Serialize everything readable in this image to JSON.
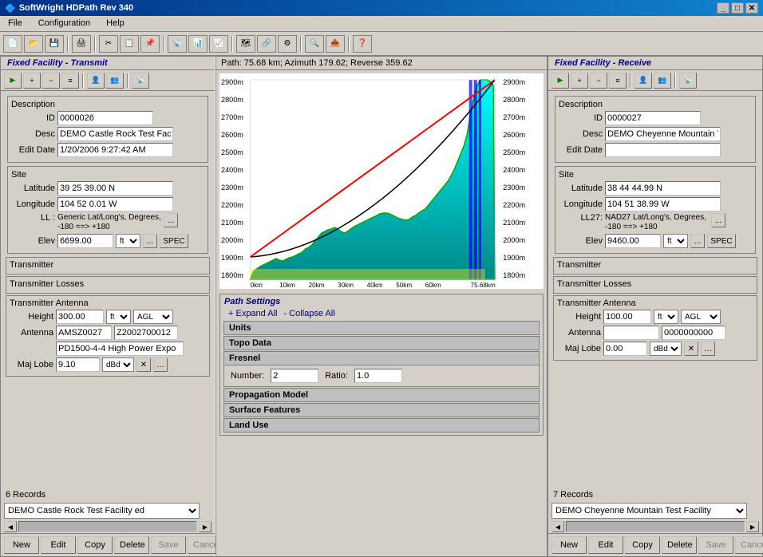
{
  "window": {
    "title": "SoftWright HDPath Rev 340",
    "title_icon": "sw-icon"
  },
  "menu": {
    "items": [
      "File",
      "Configuration",
      "Help"
    ]
  },
  "toolbar": {
    "buttons": [
      "new",
      "open",
      "save",
      "print",
      "cut",
      "copy",
      "paste",
      "undo",
      "find",
      "zoom",
      "help",
      "about"
    ]
  },
  "left_panel": {
    "header": "Fixed Facility - Transmit",
    "mini_toolbar": [
      "green-arrow",
      "plus",
      "minus",
      "list",
      "person",
      "person2",
      "tx-icon"
    ],
    "description": {
      "title": "Description",
      "id_label": "ID",
      "id_value": "0000026",
      "desc_label": "Desc",
      "desc_value": "DEMO Castle Rock Test Facilit",
      "edit_date_label": "Edit Date",
      "edit_date_value": "1/20/2006 9:27:42 AM"
    },
    "site": {
      "title": "Site",
      "latitude_label": "Latitude",
      "latitude_value": "39 25 39.00 N",
      "longitude_label": "Longitude",
      "longitude_value": "104 52 0.01 W",
      "ll_label": "LL :",
      "ll_value": "Generic Lat/Long's, Degrees, -180 ==> +180",
      "elev_label": "Elev",
      "elev_value": "6699.00",
      "elev_unit": "ft",
      "elev_agl": "SPEC"
    },
    "transmitter": {
      "title": "Transmitter"
    },
    "transmitter_losses": {
      "title": "Transmitter Losses"
    },
    "transmitter_antenna": {
      "title": "Transmitter Antenna",
      "height_label": "Height",
      "height_value": "300.00",
      "height_unit": "ft",
      "height_agl": "AGL",
      "antenna_label": "Antenna",
      "antenna_value1": "AMSZ0027",
      "antenna_value2": "Z2002700012",
      "antenna_desc": "PD1500-4-4 High Power Expo",
      "maj_lobe_label": "Maj Lobe",
      "maj_lobe_value": "9.10",
      "maj_lobe_unit": "dBd"
    },
    "records": "6 Records",
    "dropdown_value": "DEMO Castle Rock Test Facility ed",
    "action_buttons": [
      "New",
      "Edit",
      "Copy",
      "Delete",
      "Save",
      "Cancel"
    ]
  },
  "center_panel": {
    "path_info": "Path: 75.68 km; Azimuth 179.62; Reverse 359.62",
    "chart": {
      "y_axis_labels": [
        "2900m",
        "2800m",
        "2700m",
        "2600m",
        "2500m",
        "2400m",
        "2300m",
        "2200m",
        "2100m",
        "2000m",
        "1900m",
        "1800m"
      ],
      "y_axis_right": [
        "2900m",
        "2800m",
        "2700m",
        "2600m",
        "2500m",
        "2400m",
        "2300m",
        "2200m",
        "2100m",
        "2000m",
        "1900m",
        "1800m"
      ],
      "x_axis_labels": [
        "0km",
        "10km",
        "20km",
        "30km",
        "40km",
        "50km",
        "60km",
        "75.68km"
      ]
    },
    "path_settings": {
      "title": "Path Settings",
      "expand_all": "+ Expand All",
      "collapse_all": "- Collapse All",
      "units": "Units",
      "topo_data": "Topo Data",
      "fresnel": "Fresnel",
      "fresnel_number_label": "Number:",
      "fresnel_number_value": "2",
      "fresnel_ratio_label": "Ratio:",
      "fresnel_ratio_value": "1.0",
      "propagation_model": "Propagation Model",
      "surface_features": "Surface Features",
      "land_use": "Land Use"
    }
  },
  "right_panel": {
    "header": "Fixed Facility - Receive",
    "mini_toolbar": [
      "green-arrow",
      "plus",
      "minus",
      "list",
      "person",
      "person2",
      "rx-icon"
    ],
    "description": {
      "title": "Description",
      "id_label": "ID",
      "id_value": "0000027",
      "desc_label": "Desc",
      "desc_value": "DEMO Cheyenne Mountain Te",
      "edit_date_label": "Edit Date",
      "edit_date_value": ""
    },
    "site": {
      "title": "Site",
      "latitude_label": "Latitude",
      "latitude_value": "38 44 44.99 N",
      "longitude_label": "Longitude",
      "longitude_value": "104 51 38.99 W",
      "ll_label": "LL27:",
      "ll_value": "NAD27 Lat/Long's, Degrees, -180 ==> +180",
      "elev_label": "Elev",
      "elev_value": "9460.00",
      "elev_unit": "ft",
      "elev_agl": "SPEC"
    },
    "transmitter": {
      "title": "Transmitter"
    },
    "transmitter_losses": {
      "title": "Transmitter Losses"
    },
    "transmitter_antenna": {
      "title": "Transmitter Antenna",
      "height_label": "Height",
      "height_value": "100.00",
      "height_unit": "ft",
      "height_agl": "AGL",
      "antenna_label": "Antenna",
      "antenna_value1": "",
      "antenna_value2": "0000000000",
      "maj_lobe_label": "Maj Lobe",
      "maj_lobe_value": "0.00",
      "maj_lobe_unit": "dBd"
    },
    "records": "7 Records",
    "dropdown_value": "DEMO Cheyenne Mountain Test Facility",
    "action_buttons": [
      "New",
      "Edit",
      "Copy",
      "Delete",
      "Save",
      "Cancel"
    ]
  }
}
